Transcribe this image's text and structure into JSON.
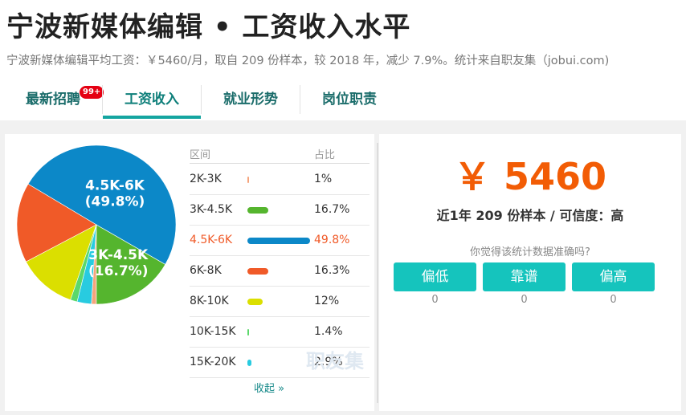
{
  "header": {
    "title": "宁波新媒体编辑 • 工资收入水平",
    "subtitle": "宁波新媒体编辑平均工资：￥5460/月，取自 209 份样本，较 2018 年，减少 7.9%。统计来自职友集（jobui.com)"
  },
  "tabs": [
    {
      "label": "最新招聘",
      "badge": "99+"
    },
    {
      "label": "工资收入",
      "active": true
    },
    {
      "label": "就业形势"
    },
    {
      "label": "岗位职责"
    }
  ],
  "table": {
    "col_range": "区间",
    "col_pct": "占比",
    "collapse_label": "收起 »"
  },
  "watermark": "职友集",
  "summary": {
    "salary": "￥ 5460",
    "sample_text": "近1年 209 份样本 / 可信度：高",
    "question": "你觉得该统计数据准确吗?",
    "votes": [
      {
        "label": "偏低",
        "count": "0"
      },
      {
        "label": "靠谱",
        "count": "0"
      },
      {
        "label": "偏高",
        "count": "0"
      }
    ]
  },
  "chart_data": {
    "type": "pie",
    "categories": [
      "2K-3K",
      "3K-4.5K",
      "4.5K-6K",
      "6K-8K",
      "8K-10K",
      "10K-15K",
      "15K-20K"
    ],
    "labels": [
      "1%",
      "16.7%",
      "49.8%",
      "16.3%",
      "12%",
      "1.4%",
      "2.9%"
    ],
    "values": [
      1,
      16.7,
      49.8,
      16.3,
      12,
      1.4,
      2.9
    ],
    "colors": [
      "#f5a47c",
      "#55b52e",
      "#0c88c8",
      "#f05a28",
      "#dbdf00",
      "#5bd86a",
      "#28cbe0"
    ],
    "highlight_index": 2,
    "pie_labels": [
      {
        "index": 2,
        "line1": "4.5K-6K",
        "line2": "(49.8%)"
      },
      {
        "index": 1,
        "line1": "3K-4.5K",
        "line2": "(16.7%)"
      }
    ]
  }
}
